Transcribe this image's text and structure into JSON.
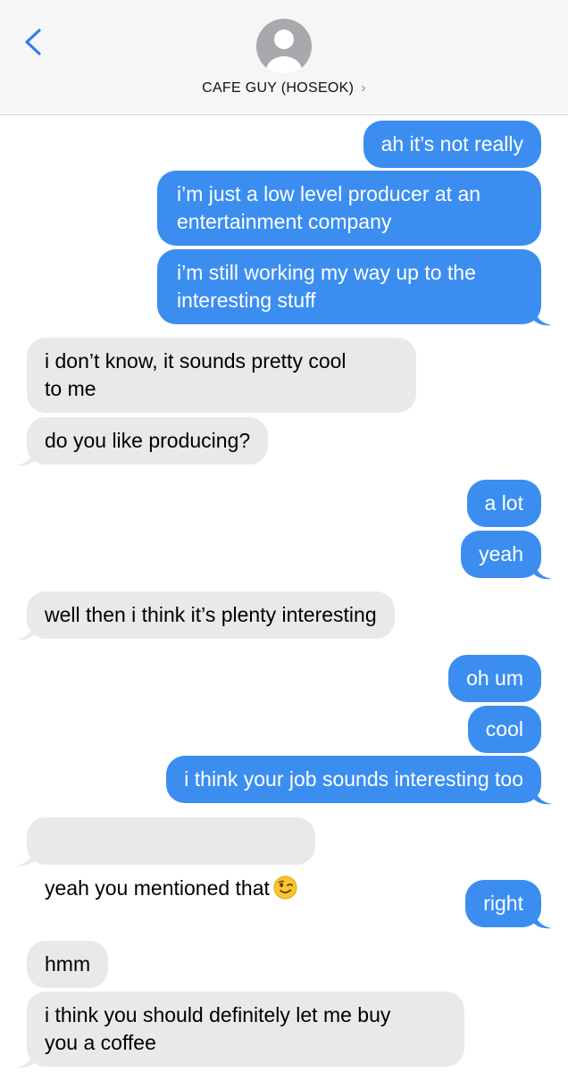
{
  "header": {
    "back_icon": "chevron-left-icon",
    "contact_name": "CAFE GUY (HOSEOK)",
    "contact_chevron": "›",
    "avatar_icon": "person-icon"
  },
  "colors": {
    "outgoing_bubble": "#3b8ef0",
    "incoming_bubble": "#e9e9eb",
    "accent": "#2f7cf6"
  },
  "messages": [
    {
      "side": "out",
      "text": "ah it’s not really"
    },
    {
      "side": "out",
      "text": "i’m just a low level producer at an\nentertainment company"
    },
    {
      "side": "out",
      "text": "i’m still working my way up to the\ninteresting stuff"
    },
    {
      "side": "in",
      "text": "i don’t know, it sounds pretty cool\nto me"
    },
    {
      "side": "in",
      "text": "do you like producing?"
    },
    {
      "side": "out",
      "text": "a lot"
    },
    {
      "side": "out",
      "text": "yeah"
    },
    {
      "side": "in",
      "text": "well then i think it’s plenty interesting"
    },
    {
      "side": "out",
      "text": "oh um"
    },
    {
      "side": "out",
      "text": "cool"
    },
    {
      "side": "out",
      "text": "i think your job sounds interesting too"
    },
    {
      "side": "in",
      "text": "yeah you mentioned that",
      "emoji": "winking-face-icon"
    },
    {
      "side": "out",
      "text": "right"
    },
    {
      "side": "in",
      "text": "hmm"
    },
    {
      "side": "in",
      "text": "i think you should definitely let me buy\nyou a coffee"
    }
  ]
}
